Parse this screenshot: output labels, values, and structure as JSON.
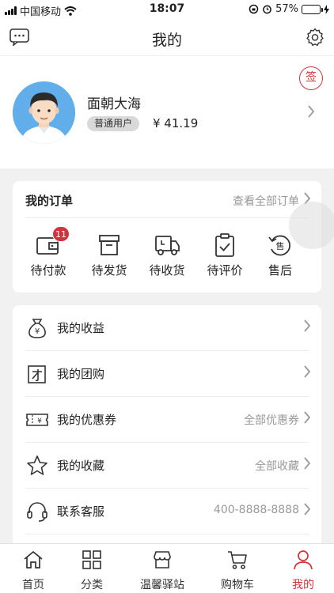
{
  "status_bar": {
    "carrier": "中国移动",
    "time": "18:07",
    "battery": "57%",
    "battery_level": 0.57
  },
  "nav": {
    "title": "我的"
  },
  "profile": {
    "name": "面朝大海",
    "role": "普通用户",
    "balance": "¥ 41.19",
    "checkin_label": "签"
  },
  "orders": {
    "title": "我的订单",
    "view_all": "查看全部订单",
    "items": [
      {
        "label": "待付款",
        "icon": "wallet-icon",
        "badge": "11"
      },
      {
        "label": "待发货",
        "icon": "box-icon"
      },
      {
        "label": "待收货",
        "icon": "truck-icon"
      },
      {
        "label": "待评价",
        "icon": "clipboard-check-icon"
      },
      {
        "label": "售后",
        "icon": "after-sales-icon"
      }
    ]
  },
  "menu": [
    {
      "label": "我的收益",
      "value": "",
      "icon": "money-bag-icon"
    },
    {
      "label": "我的团购",
      "value": "",
      "icon": "group-buy-icon"
    },
    {
      "label": "我的优惠券",
      "value": "全部优惠券",
      "icon": "coupon-icon"
    },
    {
      "label": "我的收藏",
      "value": "全部收藏",
      "icon": "star-icon"
    },
    {
      "label": "联系客服",
      "value": "400-8888-8888",
      "icon": "headset-icon"
    }
  ],
  "tabs": [
    {
      "label": "首页",
      "icon": "home-icon"
    },
    {
      "label": "分类",
      "icon": "grid-icon"
    },
    {
      "label": "温馨驿站",
      "icon": "shop-icon"
    },
    {
      "label": "购物车",
      "icon": "cart-icon"
    },
    {
      "label": "我的",
      "icon": "user-icon",
      "active": true
    }
  ],
  "colors": {
    "accent": "#d0343d",
    "muted_text": "#999999",
    "page_bg": "#f1f1f1"
  }
}
